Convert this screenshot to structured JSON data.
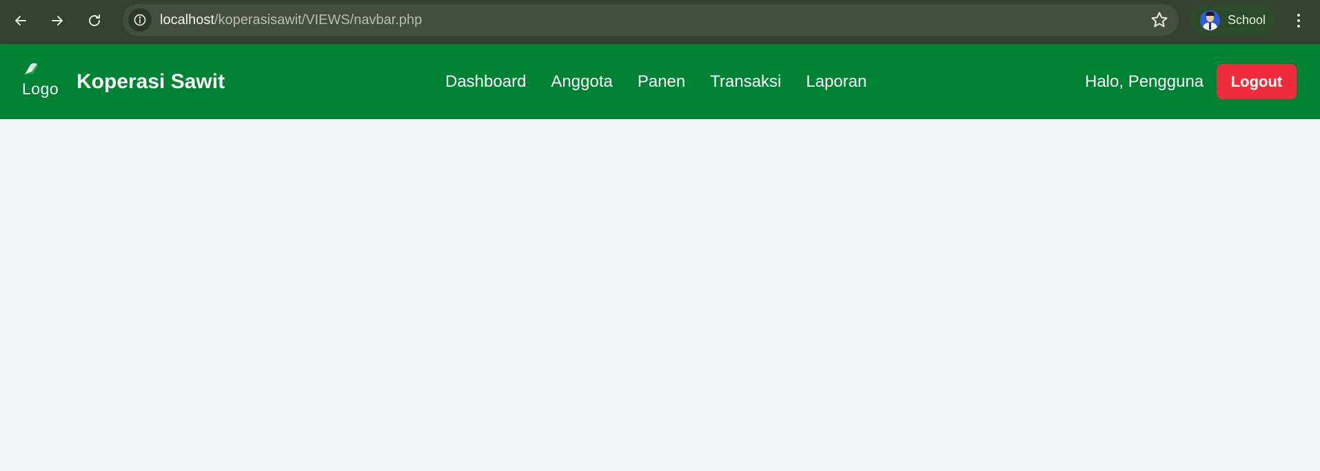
{
  "browser": {
    "url_host": "localhost",
    "url_path": "/koperasisawit/VIEWS/navbar.php",
    "profile_name": "School",
    "icons": {
      "back": "arrow-left-icon",
      "forward": "arrow-right-icon",
      "reload": "reload-icon",
      "site_info": "info-icon",
      "bookmark": "star-icon",
      "menu": "more-vertical-icon"
    }
  },
  "navbar": {
    "logo_alt": "Logo",
    "brand": "Koperasi Sawit",
    "menu": [
      {
        "label": "Dashboard"
      },
      {
        "label": "Anggota"
      },
      {
        "label": "Panen"
      },
      {
        "label": "Transaksi"
      },
      {
        "label": "Laporan"
      }
    ],
    "greeting": "Halo, Pengguna",
    "logout_label": "Logout"
  },
  "colors": {
    "navbar_bg": "#008234",
    "logout_bg": "#ef2c3c",
    "page_bg": "#f3f4f6",
    "chrome_bg": "#35402f"
  }
}
